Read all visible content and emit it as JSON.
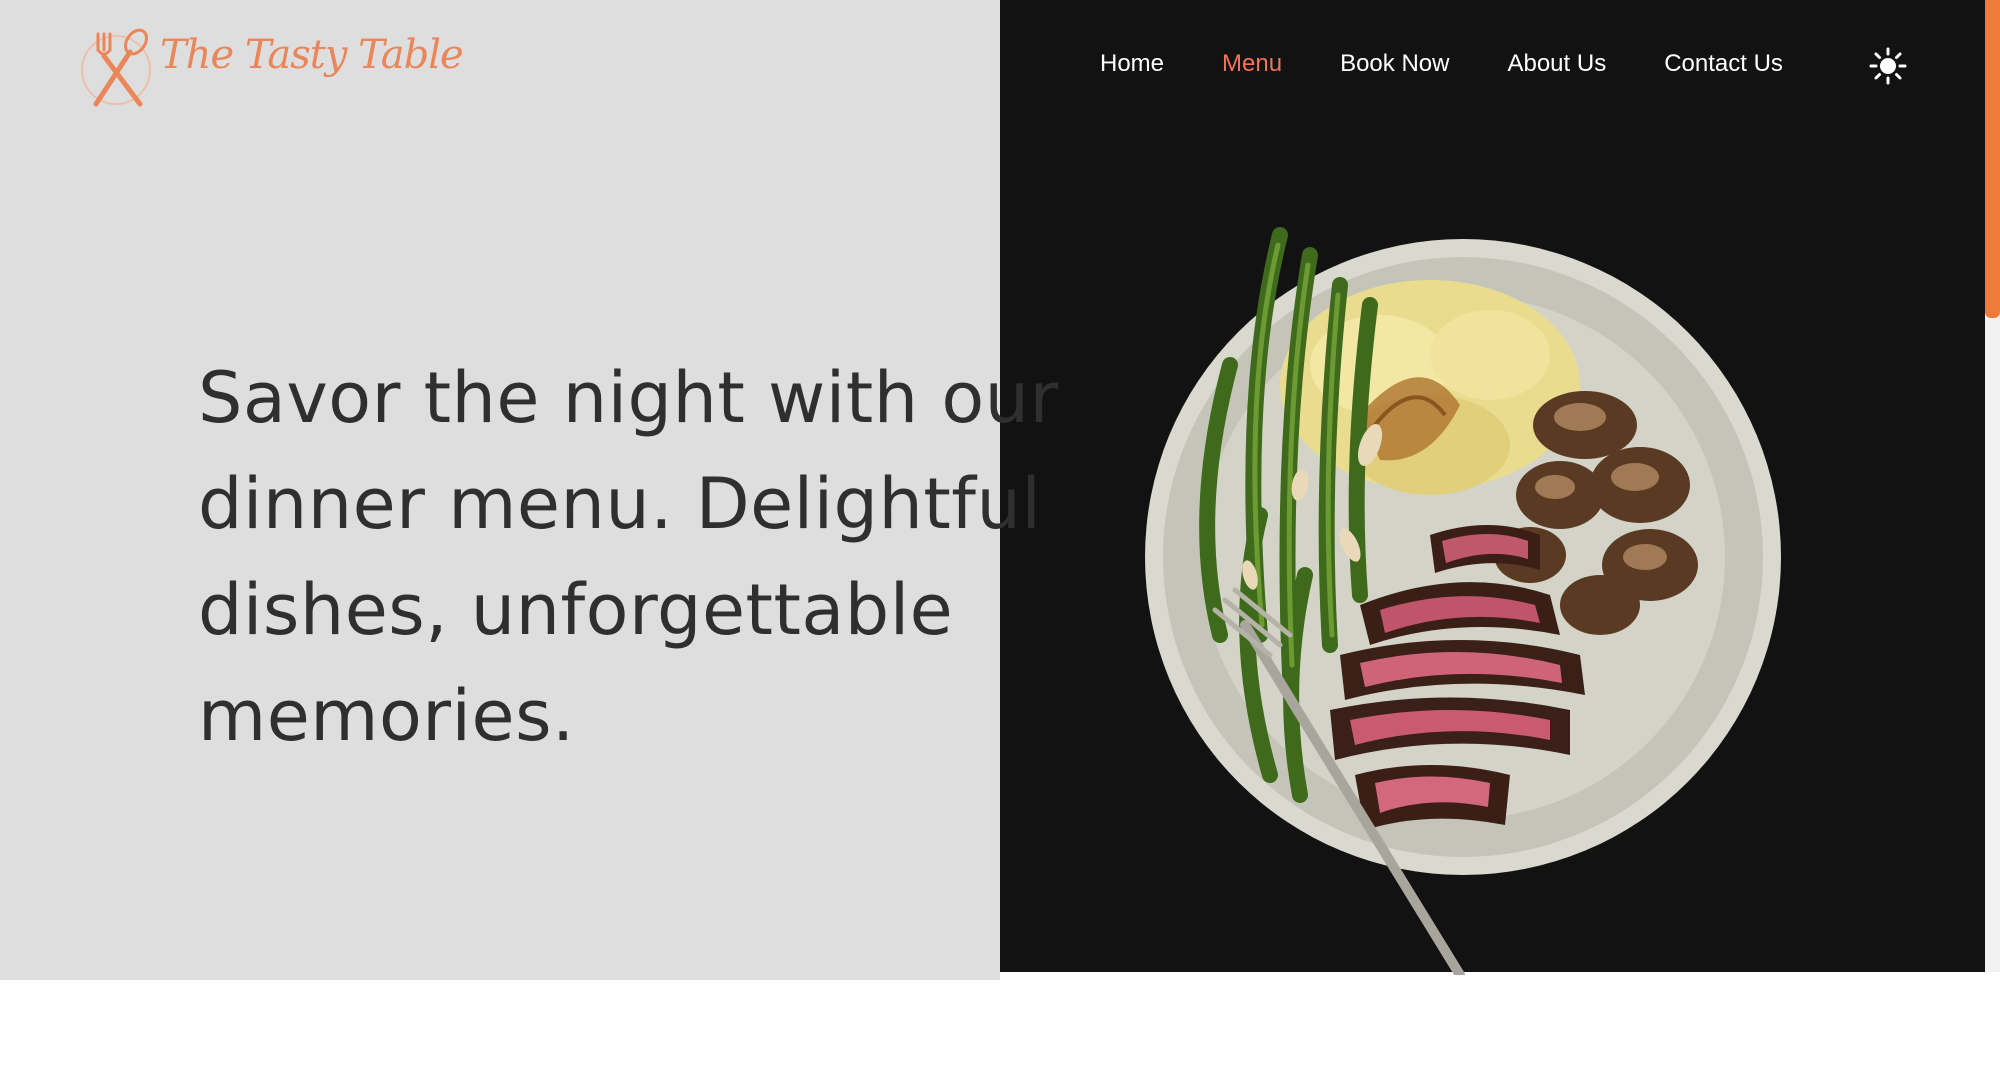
{
  "brand": {
    "name": "The Tasty Table",
    "accent_color": "#e9875a"
  },
  "nav": {
    "items": [
      {
        "label": "Home",
        "active": false
      },
      {
        "label": "Menu",
        "active": true
      },
      {
        "label": "Book Now",
        "active": false
      },
      {
        "label": "About Us",
        "active": false
      },
      {
        "label": "Contact Us",
        "active": false
      }
    ],
    "active_color": "#f0735a",
    "theme_toggle_icon": "sun-icon"
  },
  "hero": {
    "headline": "Savor the night with our dinner menu. Delightful dishes, unforgettable memories.",
    "left_background": "#dedede",
    "right_background": "#121212",
    "image_subject": "plate-steak-mushrooms-mashed-potatoes-green-beans"
  },
  "scrollbar": {
    "thumb_color": "#f07a3a",
    "position": 0
  }
}
